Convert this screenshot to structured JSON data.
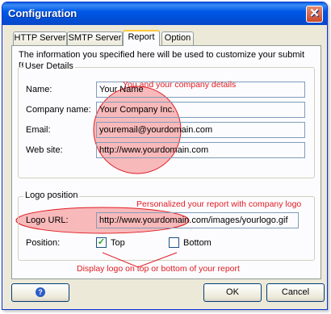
{
  "window": {
    "title": "Configuration",
    "close_symbol": "✕"
  },
  "tabs": [
    {
      "label": "HTTP Server"
    },
    {
      "label": "SMTP Server"
    },
    {
      "label": "Report"
    },
    {
      "label": "Option"
    }
  ],
  "active_tab": "Report",
  "report": {
    "info_text": "The information you specified here will be used to customize your submit reports.",
    "user_details": {
      "legend": "User Details",
      "fields": [
        {
          "label": "Name:",
          "value": "Your Name"
        },
        {
          "label": "Company name:",
          "value": "Your Company Inc."
        },
        {
          "label": "Email:",
          "value": "youremail@yourdomain.com"
        },
        {
          "label": "Web site:",
          "value": "http://www.yourdomain.com"
        }
      ]
    },
    "logo_position": {
      "legend": "Logo position",
      "url_label": "Logo URL:",
      "url_value": "http://www.yourdomain.com/images/yourlogo.gif",
      "position_label": "Position:",
      "options": [
        {
          "label": "Top",
          "checked": true
        },
        {
          "label": "Bottom",
          "checked": false
        }
      ]
    }
  },
  "annotations": {
    "company_details": "You and your company details",
    "logo": "Personalized your report with company logo",
    "position": "Display logo on top or bottom of your report"
  },
  "buttons": {
    "ok": "OK",
    "cancel": "Cancel",
    "help_symbol": "?"
  },
  "colors": {
    "annotation_red": "#e01b22",
    "titlebar_blue": "#0058e6",
    "circle_fill": "#f5a0a0"
  }
}
